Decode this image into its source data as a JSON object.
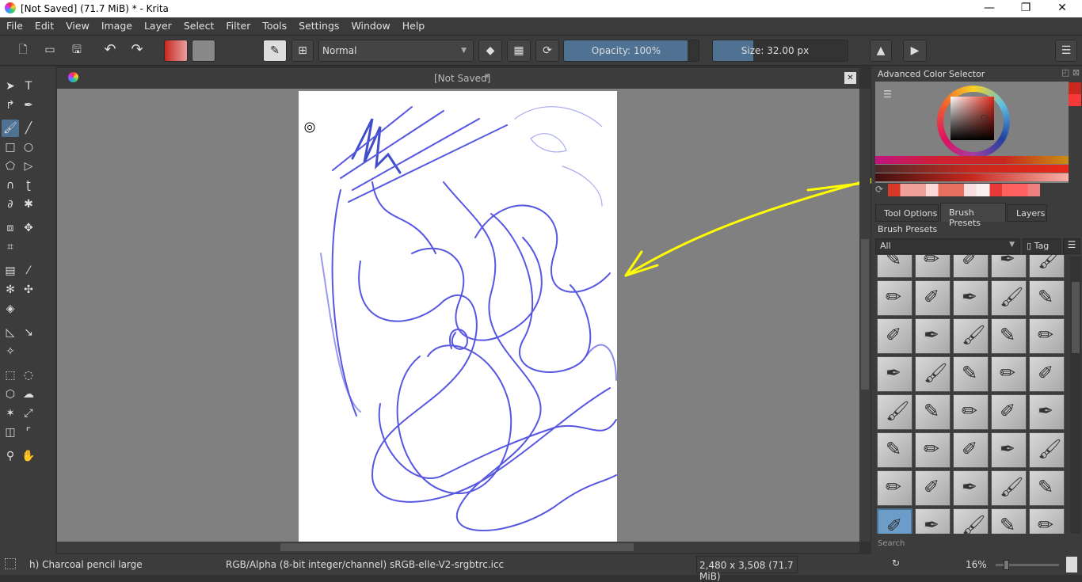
{
  "window": {
    "title": "[Not Saved]  (71.7 MiB)  * - Krita",
    "minimize": "—",
    "maximize": "❐",
    "close": "✕"
  },
  "menu": [
    "File",
    "Edit",
    "View",
    "Image",
    "Layer",
    "Select",
    "Filter",
    "Tools",
    "Settings",
    "Window",
    "Help"
  ],
  "toolbar": {
    "blend_mode": "Normal",
    "opacity_label": "Opacity: 100%",
    "opacity_value": 100,
    "size_label": "Size: 32.00 px",
    "size_fill_percent": 30,
    "fg_color": "#c8281e",
    "bg_color": "#000000"
  },
  "document": {
    "tab_title": "[Not Saved]",
    "modified_mark": "*",
    "close": "✕"
  },
  "docker": {
    "color_selector_title": "Advanced Color Selector",
    "tabs": [
      "Tool Options",
      "Brush Presets",
      "Layers"
    ],
    "active_tab": "Brush Presets",
    "brush_presets_title": "Brush Presets",
    "tag_filter": "All",
    "tag_button": "Tag",
    "search_placeholder": "Search"
  },
  "status": {
    "brush": "h) Charcoal pencil large",
    "color_space": "RGB/Alpha (8-bit integer/channel)  sRGB-elle-V2-srgbtrc.icc",
    "dimensions": "2,480 x 3,508 (71.7 MiB)",
    "zoom": "16%"
  },
  "colors": {
    "accent": "#4f7192",
    "stroke": "#3a3adc",
    "annotation": "#ffff00"
  }
}
